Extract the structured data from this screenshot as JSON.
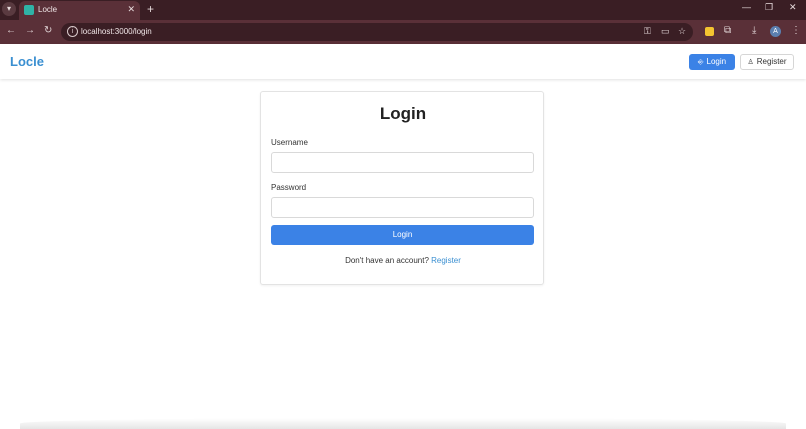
{
  "browser": {
    "tab_title": "Locle",
    "url": "localhost:3000/login",
    "new_tab_glyph": "+",
    "profile_initial": "A"
  },
  "navbar": {
    "brand": "Locle",
    "login_label": "Login",
    "register_label": "Register"
  },
  "form": {
    "title": "Login",
    "username_label": "Username",
    "username_value": "",
    "password_label": "Password",
    "password_value": "",
    "submit_label": "Login",
    "footer_text": "Don't have an account?",
    "footer_link": "Register"
  },
  "colors": {
    "primary": "#3b82e6",
    "brand": "#3a8fd1",
    "chrome_dark": "#3a1e24",
    "chrome_mid": "#5a3038"
  }
}
